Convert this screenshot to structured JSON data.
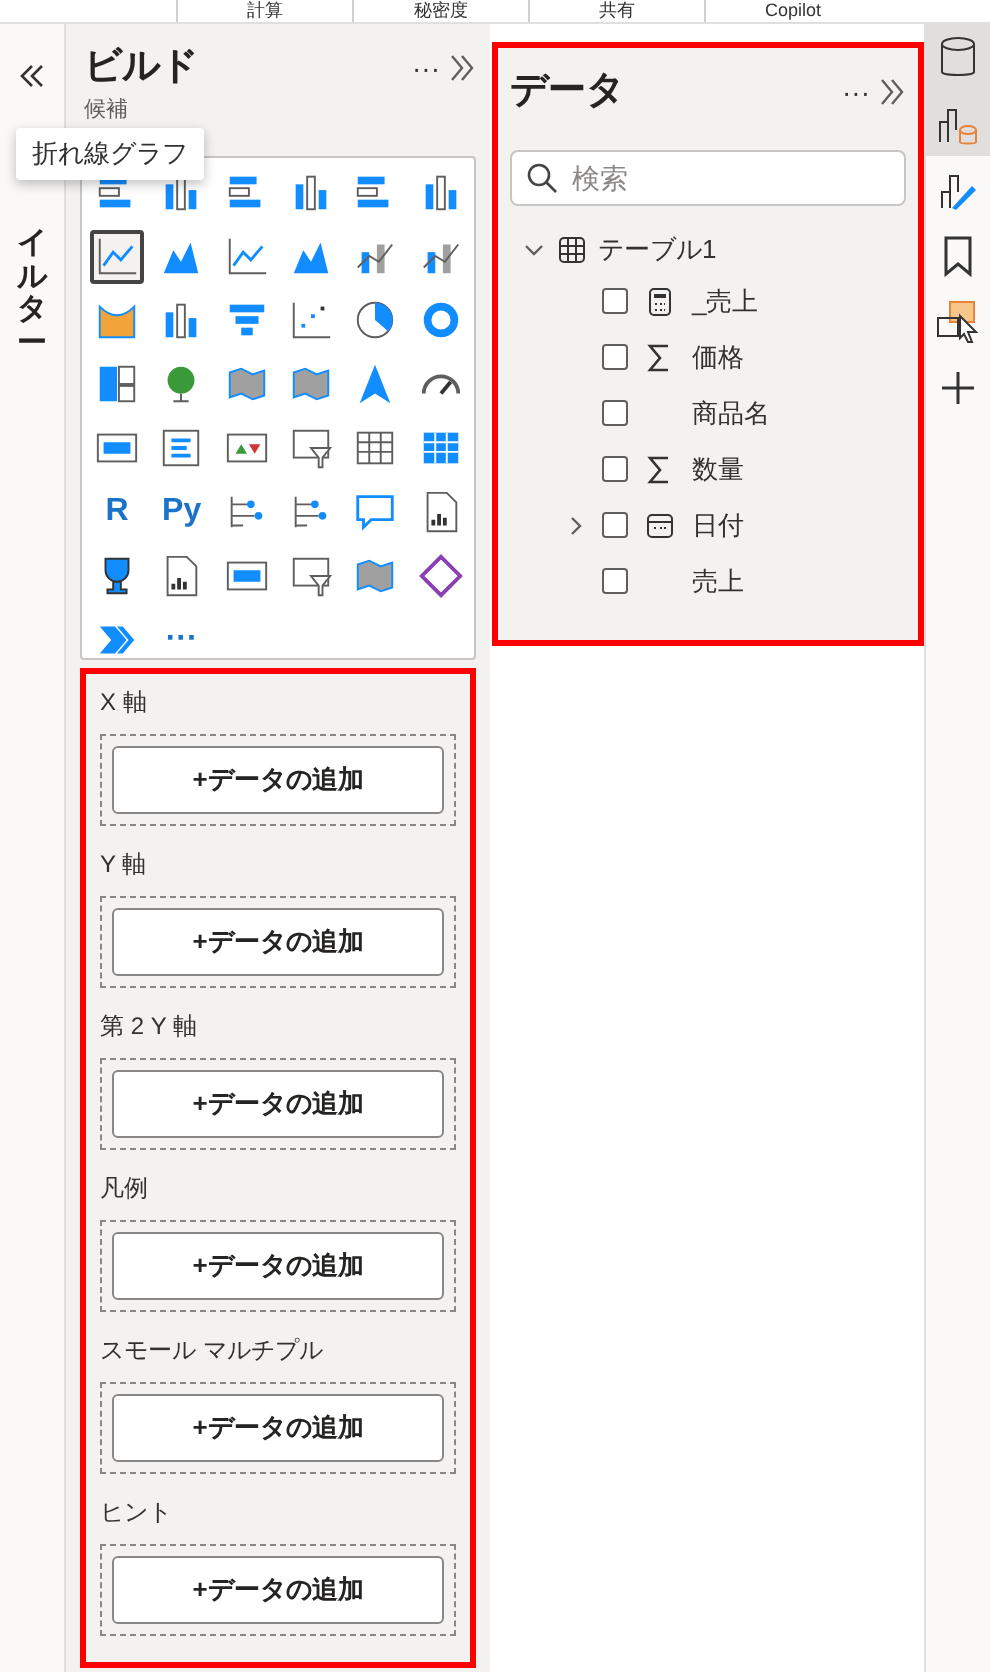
{
  "top_tabs": [
    "計算",
    "秘密度",
    "共有",
    "Copilot"
  ],
  "filter_pane": {
    "label": "イルター"
  },
  "tooltip": "折れ線グラフ",
  "build": {
    "title": "ビルド",
    "more": "···",
    "section": "候補",
    "visuals": [
      {
        "kind": "stacked-bar",
        "selected": false
      },
      {
        "kind": "column",
        "selected": false
      },
      {
        "kind": "stacked-bar",
        "selected": false
      },
      {
        "kind": "column",
        "selected": false
      },
      {
        "kind": "stacked-bar",
        "selected": false
      },
      {
        "kind": "column",
        "selected": false
      },
      {
        "kind": "line",
        "selected": true
      },
      {
        "kind": "area",
        "selected": false
      },
      {
        "kind": "line",
        "selected": false
      },
      {
        "kind": "area",
        "selected": false
      },
      {
        "kind": "combo",
        "selected": false
      },
      {
        "kind": "combo",
        "selected": false
      },
      {
        "kind": "ribbon",
        "selected": false
      },
      {
        "kind": "column",
        "selected": false
      },
      {
        "kind": "funnel",
        "selected": false
      },
      {
        "kind": "scatter",
        "selected": false
      },
      {
        "kind": "pie",
        "selected": false
      },
      {
        "kind": "donut",
        "selected": false
      },
      {
        "kind": "treemap",
        "selected": false
      },
      {
        "kind": "globe",
        "selected": false
      },
      {
        "kind": "map",
        "selected": false
      },
      {
        "kind": "map",
        "selected": false
      },
      {
        "kind": "arrow",
        "selected": false
      },
      {
        "kind": "gauge",
        "selected": false
      },
      {
        "kind": "card",
        "selected": false
      },
      {
        "kind": "list",
        "selected": false
      },
      {
        "kind": "kpi",
        "selected": false
      },
      {
        "kind": "slicer",
        "selected": false
      },
      {
        "kind": "table",
        "selected": false
      },
      {
        "kind": "matrix",
        "selected": false
      },
      {
        "kind": "glyph",
        "label": "R",
        "selected": false
      },
      {
        "kind": "glyph",
        "label": "Py",
        "selected": false
      },
      {
        "kind": "tree",
        "selected": false
      },
      {
        "kind": "tree",
        "selected": false
      },
      {
        "kind": "speech",
        "selected": false
      },
      {
        "kind": "doc",
        "selected": false
      },
      {
        "kind": "trophy",
        "selected": false
      },
      {
        "kind": "doc",
        "selected": false
      },
      {
        "kind": "card",
        "selected": false
      },
      {
        "kind": "slicer",
        "selected": false
      },
      {
        "kind": "map",
        "selected": false
      },
      {
        "kind": "diamond",
        "selected": false
      },
      {
        "kind": "chevron",
        "selected": false
      },
      {
        "kind": "glyph",
        "label": "···",
        "selected": false
      }
    ],
    "wells": [
      {
        "label": "X 軸",
        "button": "+データの追加"
      },
      {
        "label": "Y 軸",
        "button": "+データの追加"
      },
      {
        "label": "第 2 Y 軸",
        "button": "+データの追加"
      },
      {
        "label": "凡例",
        "button": "+データの追加"
      },
      {
        "label": "スモール マルチプル",
        "button": "+データの追加"
      },
      {
        "label": "ヒント",
        "button": "+データの追加"
      }
    ]
  },
  "data": {
    "title": "データ",
    "more": "···",
    "search": {
      "placeholder": "検索"
    },
    "tables": [
      {
        "name": "テーブル1",
        "expanded": true,
        "fields": [
          {
            "name": "_売上",
            "kind": "measure",
            "checked": false
          },
          {
            "name": "価格",
            "kind": "sum",
            "checked": false
          },
          {
            "name": "商品名",
            "kind": "plain",
            "checked": false
          },
          {
            "name": "数量",
            "kind": "sum",
            "checked": false
          },
          {
            "name": "日付",
            "kind": "date",
            "checked": false,
            "expanded": false
          },
          {
            "name": "売上",
            "kind": "plain",
            "checked": false
          }
        ]
      }
    ]
  },
  "right_rail": [
    {
      "kind": "database",
      "selected": true
    },
    {
      "kind": "build",
      "selected": true
    },
    {
      "kind": "format",
      "selected": false
    },
    {
      "kind": "bookmark",
      "selected": false
    },
    {
      "kind": "selection",
      "selected": false
    },
    {
      "kind": "add",
      "selected": false
    }
  ]
}
